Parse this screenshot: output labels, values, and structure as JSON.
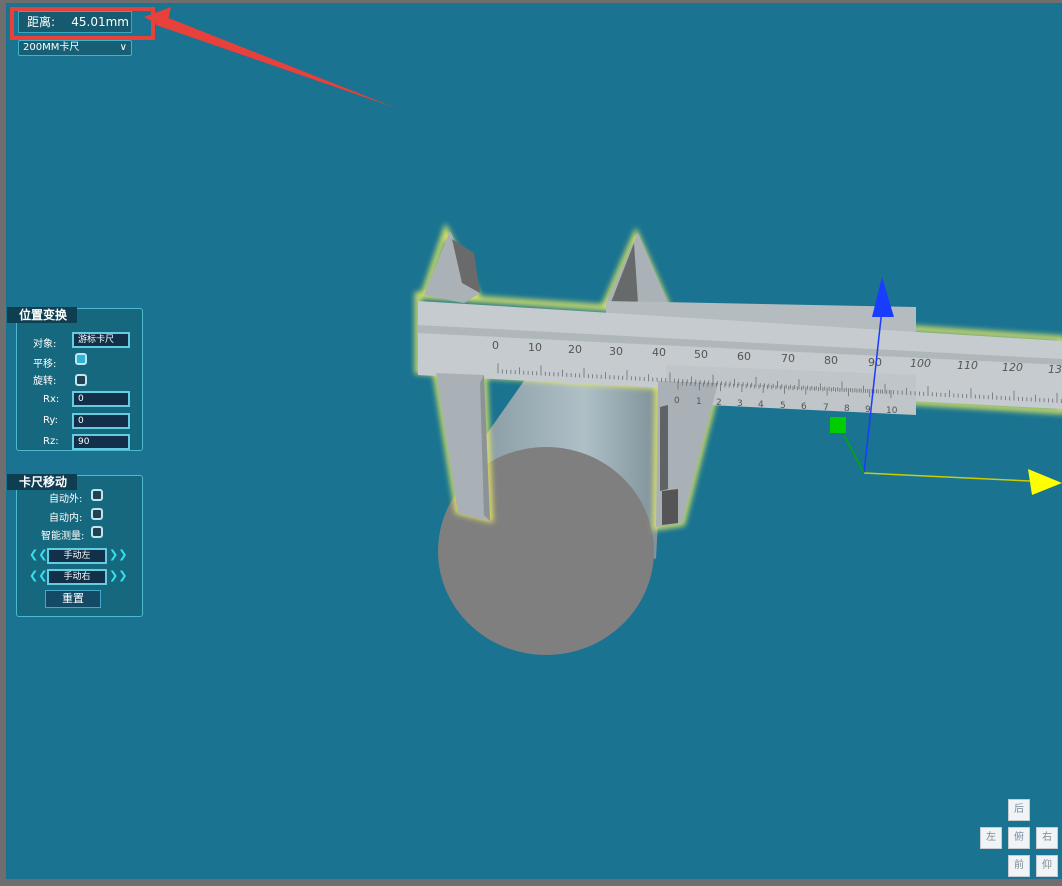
{
  "distance": {
    "label": "距离:",
    "value": "45.01mm"
  },
  "tool_select": {
    "selected": "200MM卡尺"
  },
  "transform_panel": {
    "title": "位置变换",
    "object_label": "对象:",
    "object_value": "游标卡尺",
    "translate_label": "平移:",
    "translate_checked": true,
    "rotate_label": "旋转:",
    "rotate_checked": false,
    "rx_label": "Rx:",
    "rx_value": "0",
    "ry_label": "Ry:",
    "ry_value": "0",
    "rz_label": "Rz:",
    "rz_value": "90"
  },
  "caliper_panel": {
    "title": "卡尺移动",
    "auto_outer_label": "自动外:",
    "auto_inner_label": "自动内:",
    "smart_measure_label": "智能测量:",
    "manual_left_label": "手动左",
    "manual_right_label": "手动右",
    "reset_label": "重置"
  },
  "view_buttons": {
    "back": "后",
    "left": "左",
    "top": "俯",
    "right": "右",
    "front": "前",
    "bottom": "仰"
  },
  "main_scale": {
    "labels": [
      "0",
      "10",
      "20",
      "30",
      "40",
      "50",
      "60",
      "70",
      "80",
      "90",
      "100",
      "110",
      "120",
      "13"
    ]
  },
  "vernier_scale": {
    "labels": [
      "0",
      "1",
      "2",
      "3",
      "4",
      "5",
      "6",
      "7",
      "8",
      "9",
      "10"
    ]
  },
  "colors": {
    "background": "#197391",
    "highlight_red": "#e8403a",
    "axis_x": "#ffff00",
    "axis_y": "#00cc00",
    "axis_z": "#1a3cff",
    "caliper_glow": "#f0f060"
  },
  "icons": [
    "left-arrow-icon",
    "right-arrow-icon",
    "chevron-down-icon",
    "red-annotation-arrow"
  ]
}
